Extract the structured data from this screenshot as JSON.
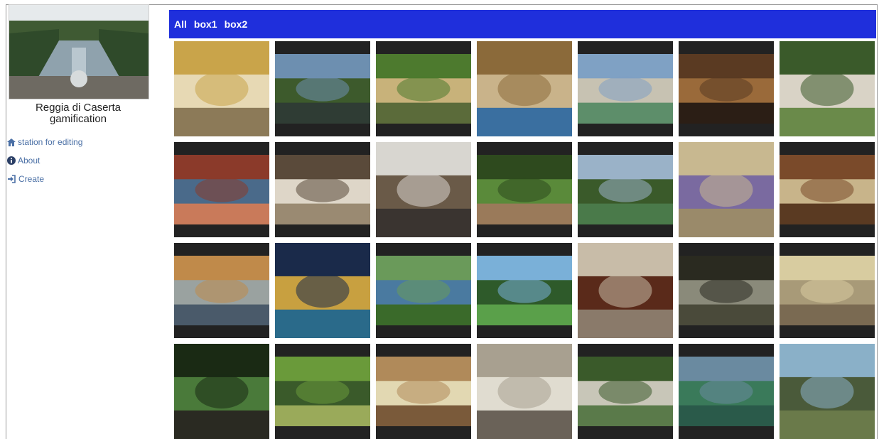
{
  "sidebar": {
    "title": "Reggia di Caserta\ngamification",
    "nav": [
      {
        "icon": "home-icon",
        "label": "station for editing"
      },
      {
        "icon": "info-icon",
        "label": "About"
      },
      {
        "icon": "login-icon",
        "label": "Create"
      }
    ]
  },
  "tabs": [
    "All",
    "box1",
    "box2"
  ],
  "colors": {
    "tabbar": "#1f2fdc",
    "link": "#4a6fa5",
    "tile_frame": "#222222"
  },
  "gallery_rows": 4,
  "gallery_cols": 7
}
